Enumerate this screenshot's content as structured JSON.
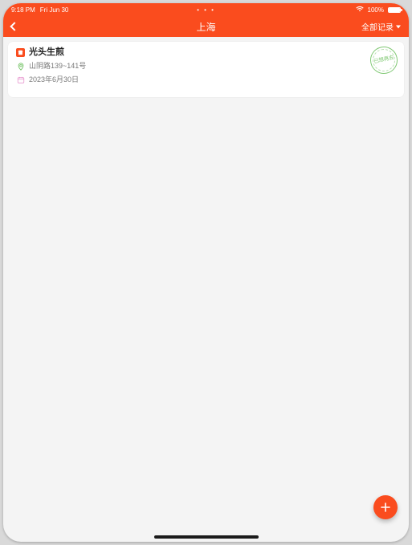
{
  "status": {
    "time": "9:18 PM",
    "date": "Fri Jun 30",
    "battery_pct": "100%"
  },
  "nav": {
    "title": "上海",
    "filter_label": "全部记录"
  },
  "card": {
    "title": "光头生煎",
    "address": "山阴路139~141号",
    "date": "2023年6月30日",
    "stamp_text": "已想再去"
  }
}
